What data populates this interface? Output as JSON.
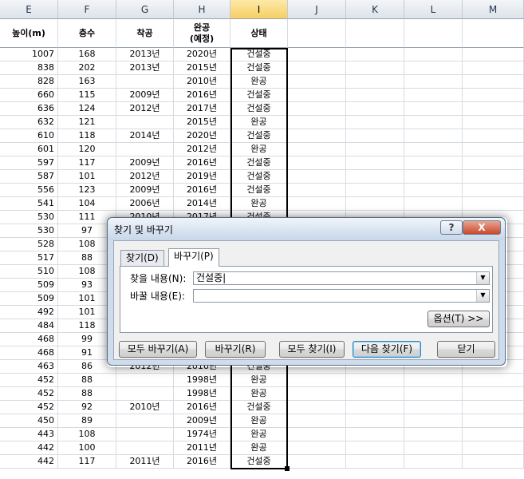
{
  "columns": [
    "E",
    "F",
    "G",
    "H",
    "I",
    "J",
    "K",
    "L",
    "M"
  ],
  "header": {
    "height": "높이(m)",
    "floors": "층수",
    "start": "착공",
    "complete": "완공\n(예정)",
    "status": "상태"
  },
  "rows": [
    {
      "h": "1007",
      "f": "168",
      "s": "2013년",
      "c": "2020년",
      "st": "건설중"
    },
    {
      "h": "838",
      "f": "202",
      "s": "2013년",
      "c": "2015년",
      "st": "건설중"
    },
    {
      "h": "828",
      "f": "163",
      "s": "",
      "c": "2010년",
      "st": "완공"
    },
    {
      "h": "660",
      "f": "115",
      "s": "2009년",
      "c": "2016년",
      "st": "건설중"
    },
    {
      "h": "636",
      "f": "124",
      "s": "2012년",
      "c": "2017년",
      "st": "건설중"
    },
    {
      "h": "632",
      "f": "121",
      "s": "",
      "c": "2015년",
      "st": "완공"
    },
    {
      "h": "610",
      "f": "118",
      "s": "2014년",
      "c": "2020년",
      "st": "건설중"
    },
    {
      "h": "601",
      "f": "120",
      "s": "",
      "c": "2012년",
      "st": "완공"
    },
    {
      "h": "597",
      "f": "117",
      "s": "2009년",
      "c": "2016년",
      "st": "건설중"
    },
    {
      "h": "587",
      "f": "101",
      "s": "2012년",
      "c": "2019년",
      "st": "건설중"
    },
    {
      "h": "556",
      "f": "123",
      "s": "2009년",
      "c": "2016년",
      "st": "건설중"
    },
    {
      "h": "541",
      "f": "104",
      "s": "2006년",
      "c": "2014년",
      "st": "완공"
    },
    {
      "h": "530",
      "f": "111",
      "s": "2010년",
      "c": "2017년",
      "st": "건설중"
    },
    {
      "h": "530",
      "f": "97",
      "s": "",
      "c": "",
      "st": ""
    },
    {
      "h": "528",
      "f": "108",
      "s": "",
      "c": "",
      "st": ""
    },
    {
      "h": "517",
      "f": "88",
      "s": "",
      "c": "",
      "st": ""
    },
    {
      "h": "510",
      "f": "108",
      "s": "",
      "c": "",
      "st": ""
    },
    {
      "h": "509",
      "f": "93",
      "s": "",
      "c": "",
      "st": ""
    },
    {
      "h": "509",
      "f": "101",
      "s": "",
      "c": "",
      "st": ""
    },
    {
      "h": "492",
      "f": "101",
      "s": "",
      "c": "",
      "st": ""
    },
    {
      "h": "484",
      "f": "118",
      "s": "",
      "c": "",
      "st": ""
    },
    {
      "h": "468",
      "f": "99",
      "s": "",
      "c": "",
      "st": ""
    },
    {
      "h": "468",
      "f": "91",
      "s": "",
      "c": "",
      "st": ""
    },
    {
      "h": "463",
      "f": "86",
      "s": "2012년",
      "c": "2016년",
      "st": "건설중"
    },
    {
      "h": "452",
      "f": "88",
      "s": "",
      "c": "1998년",
      "st": "완공"
    },
    {
      "h": "452",
      "f": "88",
      "s": "",
      "c": "1998년",
      "st": "완공"
    },
    {
      "h": "452",
      "f": "92",
      "s": "2010년",
      "c": "2016년",
      "st": "건설중"
    },
    {
      "h": "450",
      "f": "89",
      "s": "",
      "c": "2009년",
      "st": "완공"
    },
    {
      "h": "443",
      "f": "108",
      "s": "",
      "c": "1974년",
      "st": "완공"
    },
    {
      "h": "442",
      "f": "100",
      "s": "",
      "c": "2011년",
      "st": "완공"
    },
    {
      "h": "442",
      "f": "117",
      "s": "2011년",
      "c": "2016년",
      "st": "건설중"
    }
  ],
  "dialog": {
    "title": "찾기 및 바꾸기",
    "help": "?",
    "close": "X",
    "tab_find": "찾기(D)",
    "tab_replace": "바꾸기(P)",
    "find_label": "찾을 내용(N):",
    "find_value": "건설중|",
    "replace_label": "바꿀 내용(E):",
    "replace_value": "",
    "options_button": "옵션(T) >>",
    "replace_all": "모두 바꾸기(A)",
    "replace": "바꾸기(R)",
    "find_all": "모두 찾기(I)",
    "find_next": "다음 찾기(F)",
    "close_button": "닫기"
  }
}
